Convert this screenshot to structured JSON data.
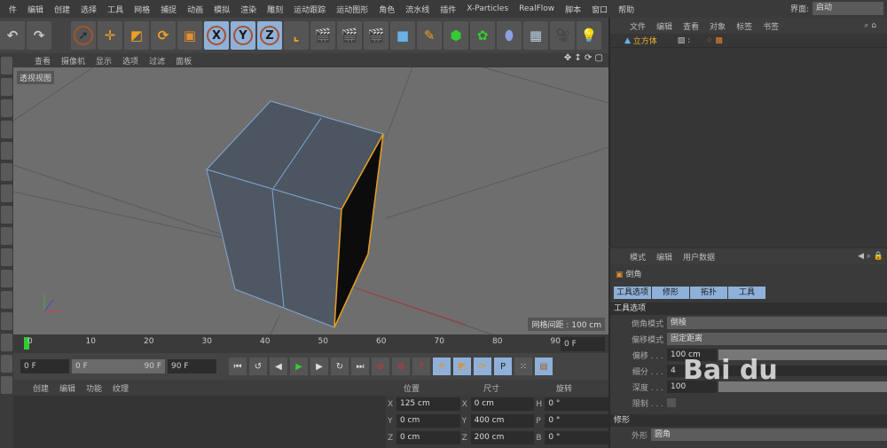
{
  "menu": [
    "件",
    "编辑",
    "创建",
    "选择",
    "工具",
    "网格",
    "捕捉",
    "动画",
    "模拟",
    "渲染",
    "雕刻",
    "运动跟踪",
    "运动图形",
    "角色",
    "流水线",
    "插件",
    "X-Particles",
    "RealFlow",
    "脚本",
    "窗口",
    "帮助"
  ],
  "layout": {
    "label": "界面:",
    "value": "启动"
  },
  "viewport": {
    "menu": [
      "查看",
      "摄像机",
      "显示",
      "选项",
      "过滤",
      "面板"
    ],
    "label": "透视视图",
    "grid": "网格间距 : 100 cm"
  },
  "object_manager": {
    "menu": [
      "文件",
      "编辑",
      "查看",
      "对象",
      "标签",
      "书签"
    ],
    "object": "立方体"
  },
  "attributes": {
    "menu": [
      "模式",
      "编辑",
      "用户数据"
    ],
    "tool": "倒角",
    "tabs": [
      "工具选项",
      "修形",
      "拓扑",
      "工具"
    ],
    "section": "工具选项",
    "bevel_mode_label": "倒角模式",
    "bevel_mode": "倒棱",
    "offset_mode_label": "偏移模式",
    "offset_mode": "固定距离",
    "offset_label": "偏移 . . .",
    "offset": "100 cm",
    "subdiv_label": "细分 . . .",
    "subdiv": "4",
    "depth_label": "深度 . . .",
    "depth": "100",
    "limit_label": "限制 . . .",
    "section2": "修形",
    "shape_label": "外形",
    "shape": "圆角"
  },
  "timeline": {
    "ticks": [
      "0",
      "10",
      "20",
      "30",
      "40",
      "50",
      "60",
      "70",
      "80",
      "90"
    ],
    "current": "0 F"
  },
  "controls": {
    "start": "0 F",
    "range_start": "0 F",
    "range_end": "90 F",
    "end": "90 F"
  },
  "material": {
    "menu": [
      "创建",
      "编辑",
      "功能",
      "纹理"
    ]
  },
  "coords": {
    "headers": [
      "位置",
      "尺寸",
      "旋转"
    ],
    "rows": [
      [
        "X",
        "125 cm",
        "X",
        "0 cm",
        "H",
        "0 °"
      ],
      [
        "Y",
        "0 cm",
        "Y",
        "400 cm",
        "P",
        "0 °"
      ],
      [
        "Z",
        "0 cm",
        "Z",
        "200 cm",
        "B",
        "0 °"
      ]
    ]
  },
  "watermark": "Bai du"
}
